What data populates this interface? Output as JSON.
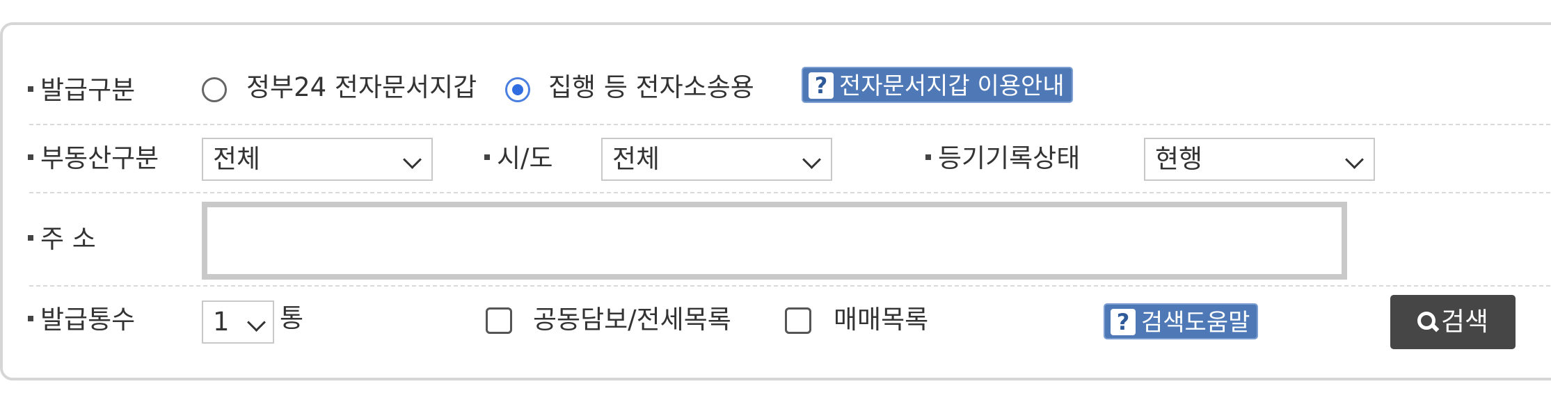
{
  "row1": {
    "label": "발급구분",
    "radio_options": [
      "정부24 전자문서지갑",
      "집행 등 전자소송용"
    ],
    "selected_index": 1,
    "help_button": "전자문서지갑 이용안내"
  },
  "row2": {
    "property_type": {
      "label": "부동산구분",
      "value": "전체"
    },
    "region": {
      "label": "시/도",
      "value": "전체"
    },
    "record_status": {
      "label": "등기기록상태",
      "value": "현행"
    }
  },
  "row3": {
    "label": "주 소",
    "address_value": ""
  },
  "row4": {
    "label": "발급통수",
    "count_value": "1",
    "count_unit": "통",
    "checkbox_joint": "공동담보/전세목록",
    "checkbox_trade": "매매목록",
    "help_button": "검색도움말",
    "search_button": "검색"
  },
  "colors": {
    "help_button_bg": "#4e79b6",
    "search_button_bg": "#464646",
    "radio_selected": "#2f6de0",
    "border": "#d6d6d6"
  },
  "icons": {
    "help": "question-mark-icon",
    "search": "magnifier-icon",
    "dropdown": "chevron-down-icon"
  }
}
